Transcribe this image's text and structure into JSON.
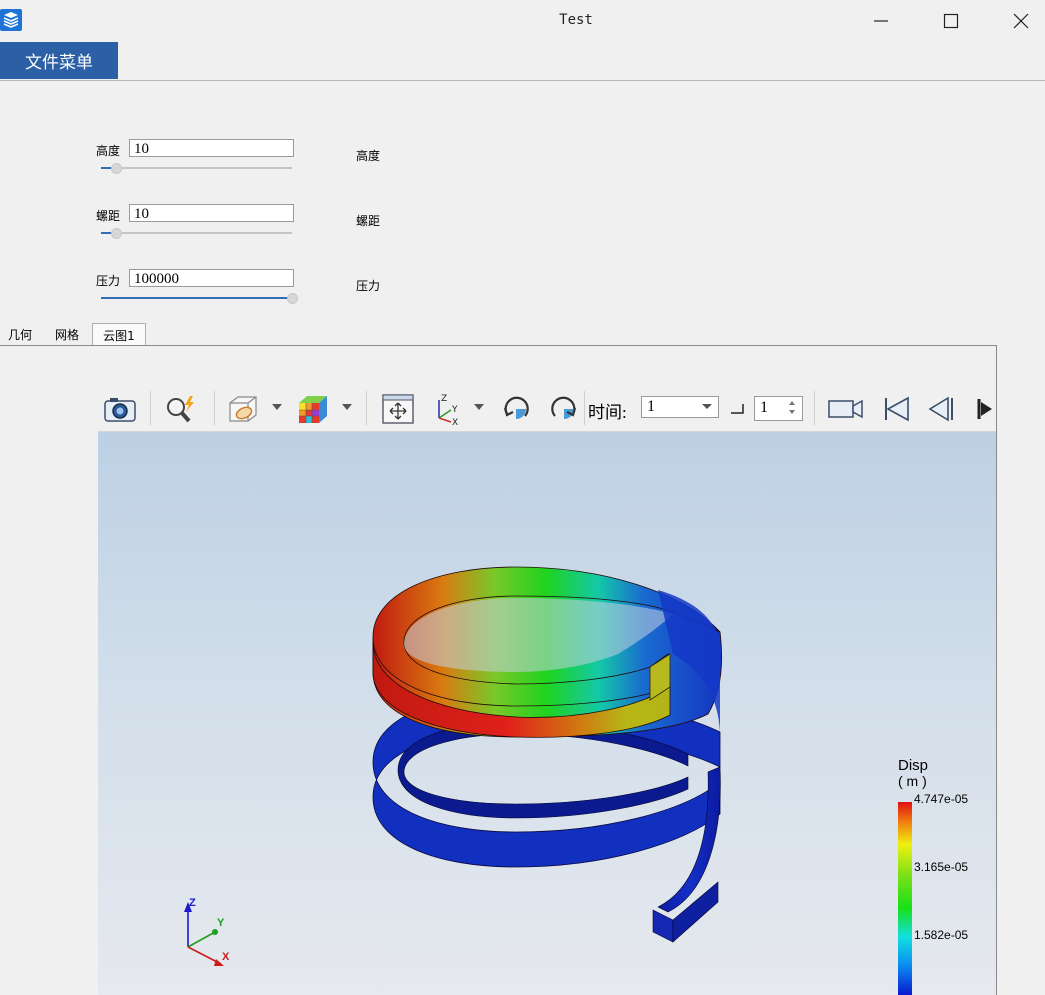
{
  "window": {
    "title": "Test",
    "controls": [
      "minimize",
      "maximize",
      "close"
    ]
  },
  "menu": {
    "file_menu_label": "文件菜单"
  },
  "params": [
    {
      "label": "高度",
      "value": "10",
      "side_label": "高度",
      "slider_fraction": 0.08
    },
    {
      "label": "螺距",
      "value": "10",
      "side_label": "螺距",
      "slider_fraction": 0.08
    },
    {
      "label": "压力",
      "value": "100000",
      "side_label": "压力",
      "slider_fraction": 1.0
    }
  ],
  "tabs": [
    {
      "label": "几何",
      "active": false
    },
    {
      "label": "网格",
      "active": false
    },
    {
      "label": "云图1",
      "active": true
    }
  ],
  "toolbar": {
    "icons": [
      "camera-icon",
      "zoom-icon",
      "display-mode-icon",
      "color-cube-icon",
      "fit-view-icon",
      "axes-view-icon",
      "rotate-cw-icon",
      "rotate-ccw-icon",
      "record-video-icon",
      "first-frame-icon",
      "prev-frame-icon",
      "next-frame-icon"
    ],
    "time_label": "时间:",
    "time_value": "1",
    "step_value": "1"
  },
  "legend": {
    "title": "Disp",
    "unit": "( m )",
    "max_label": "4.747e-05",
    "mid_label": "3.165e-05",
    "low_label": "1.582e-05"
  },
  "triad": {
    "z": "Z",
    "y": "Y",
    "x": "X"
  },
  "colors": {
    "menu_accent": "#2b5fa6",
    "slider_accent": "#2f6fb5"
  }
}
